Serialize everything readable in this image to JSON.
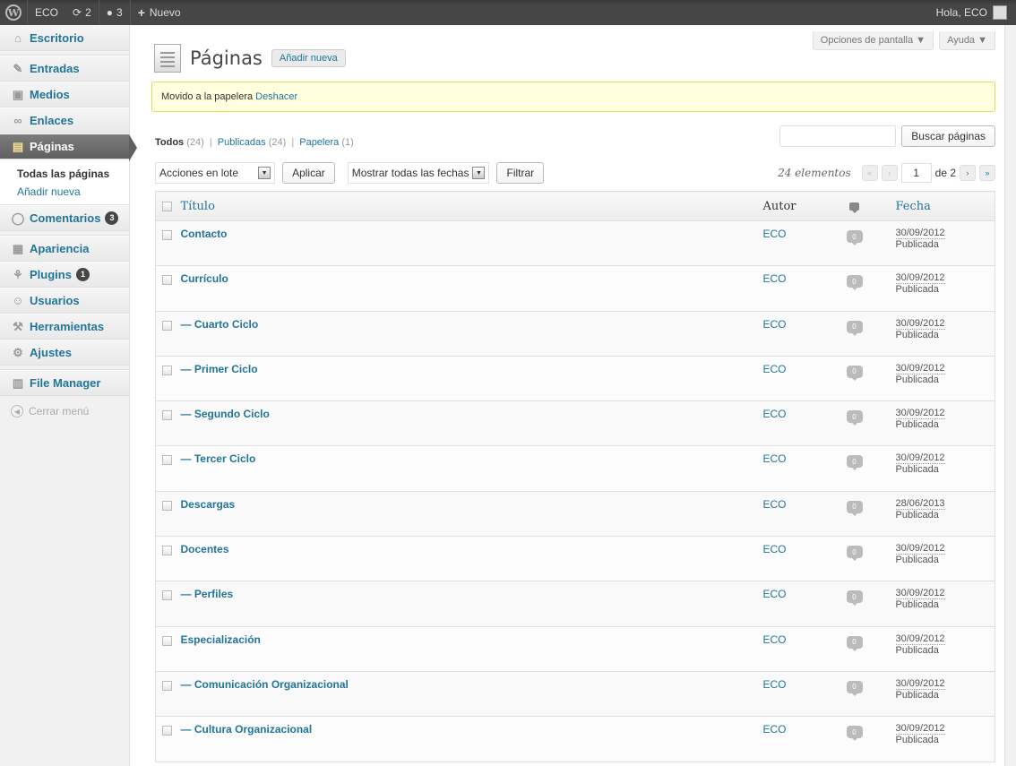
{
  "adminbar": {
    "site": "ECO",
    "updates": "2",
    "comments": "3",
    "new_label": "Nuevo",
    "greeting": "Hola, ECO"
  },
  "sidebar": {
    "items": [
      {
        "label": "Escritorio",
        "icon": "⌂"
      },
      {
        "label": "Entradas",
        "icon": "✎"
      },
      {
        "label": "Medios",
        "icon": "▣"
      },
      {
        "label": "Enlaces",
        "icon": "∞"
      },
      {
        "label": "Páginas",
        "icon": "▤"
      },
      {
        "label": "Comentarios",
        "icon": "◯",
        "badge": "3"
      },
      {
        "label": "Apariencia",
        "icon": "▦"
      },
      {
        "label": "Plugins",
        "icon": "⚘",
        "badge": "1"
      },
      {
        "label": "Usuarios",
        "icon": "☺"
      },
      {
        "label": "Herramientas",
        "icon": "⚒"
      },
      {
        "label": "Ajustes",
        "icon": "⚙"
      },
      {
        "label": "File Manager",
        "icon": "▥"
      }
    ],
    "submenu": [
      "Todas las páginas",
      "Añadir nueva"
    ],
    "collapse": "Cerrar menú"
  },
  "header": {
    "title": "Páginas",
    "add_new": "Añadir nueva",
    "screen_options": "Opciones de pantalla ▼",
    "help": "Ayuda ▼"
  },
  "notice": {
    "text": "Movido a la papelera",
    "undo": "Deshacer"
  },
  "filters": {
    "all": "Todos",
    "all_count": "(24)",
    "published": "Publicadas",
    "published_count": "(24)",
    "trash": "Papelera",
    "trash_count": "(1)",
    "sep": "|"
  },
  "search": {
    "button": "Buscar páginas"
  },
  "tablenav": {
    "bulk": "Acciones en lote",
    "apply": "Aplicar",
    "dates": "Mostrar todas las fechas",
    "filter": "Filtrar",
    "count": "24 elementos",
    "first": "«",
    "prev": "‹",
    "page": "1",
    "of": "de 2",
    "next": "›",
    "last": "»"
  },
  "table": {
    "headers": {
      "title": "Título",
      "author": "Autor",
      "date": "Fecha"
    },
    "rows": [
      {
        "title": "Contacto",
        "author": "ECO",
        "comments": "0",
        "date": "30/09/2012",
        "status": "Publicada"
      },
      {
        "title": "Currículo",
        "author": "ECO",
        "comments": "0",
        "date": "30/09/2012",
        "status": "Publicada"
      },
      {
        "title": "— Cuarto Ciclo",
        "author": "ECO",
        "comments": "0",
        "date": "30/09/2012",
        "status": "Publicada"
      },
      {
        "title": "— Primer Ciclo",
        "author": "ECO",
        "comments": "0",
        "date": "30/09/2012",
        "status": "Publicada"
      },
      {
        "title": "— Segundo Ciclo",
        "author": "ECO",
        "comments": "0",
        "date": "30/09/2012",
        "status": "Publicada"
      },
      {
        "title": "— Tercer Ciclo",
        "author": "ECO",
        "comments": "0",
        "date": "30/09/2012",
        "status": "Publicada"
      },
      {
        "title": "Descargas",
        "author": "ECO",
        "comments": "0",
        "date": "28/06/2013",
        "status": "Publicada"
      },
      {
        "title": "Docentes",
        "author": "ECO",
        "comments": "0",
        "date": "30/09/2012",
        "status": "Publicada"
      },
      {
        "title": "— Perfiles",
        "author": "ECO",
        "comments": "0",
        "date": "30/09/2012",
        "status": "Publicada"
      },
      {
        "title": "Especialización",
        "author": "ECO",
        "comments": "0",
        "date": "30/09/2012",
        "status": "Publicada"
      },
      {
        "title": "— Comunicación Organizacional",
        "author": "ECO",
        "comments": "0",
        "date": "30/09/2012",
        "status": "Publicada"
      },
      {
        "title": "— Cultura Organizacional",
        "author": "ECO",
        "comments": "0",
        "date": "30/09/2012",
        "status": "Publicada"
      }
    ]
  },
  "colors": {
    "link": "#21759b",
    "adminbar": "#464646",
    "notice_bg": "#ffffe0",
    "notice_border": "#e6db55"
  }
}
